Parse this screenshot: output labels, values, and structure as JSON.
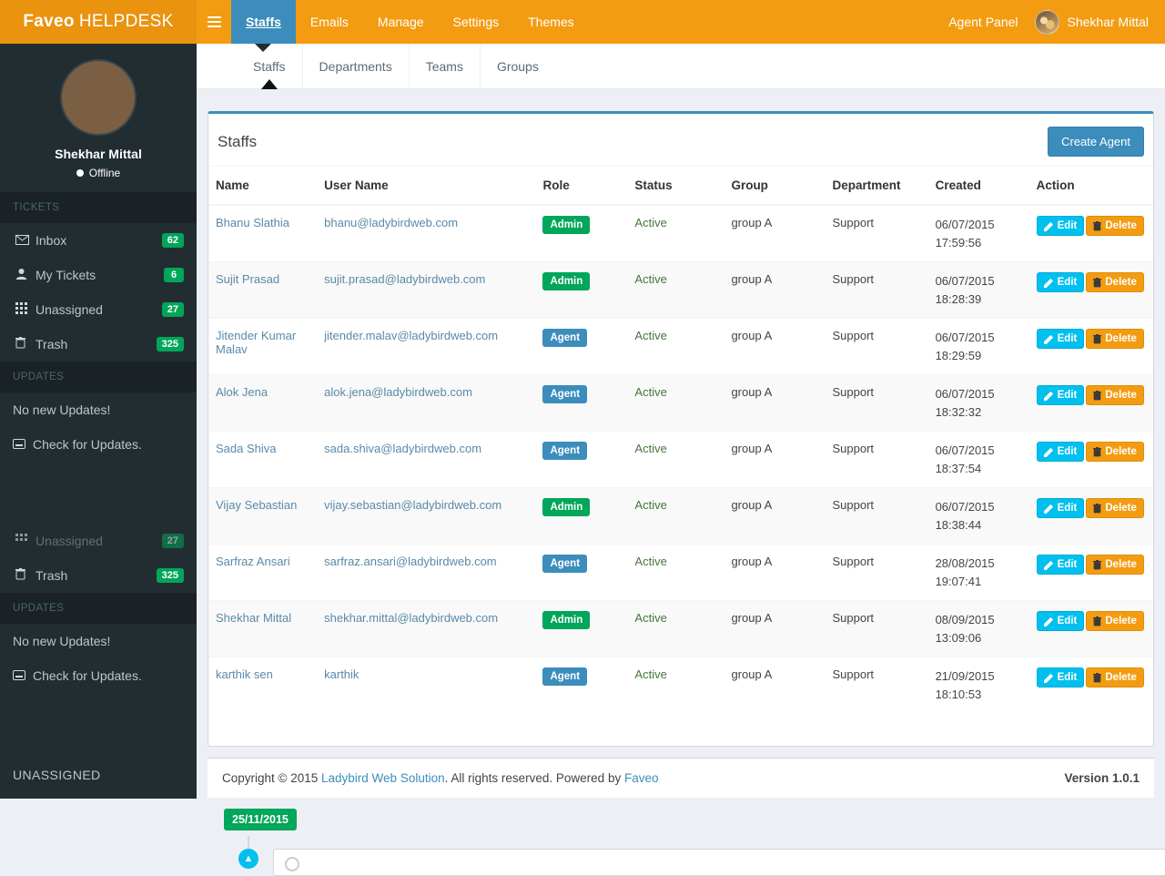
{
  "navbar": {
    "brand_bold": "Faveo",
    "brand_light": "HELPDESK",
    "menu_icon": "hamburger-icon",
    "items": [
      {
        "label": "Staffs",
        "active": true
      },
      {
        "label": "Emails",
        "active": false
      },
      {
        "label": "Manage",
        "active": false
      },
      {
        "label": "Settings",
        "active": false
      },
      {
        "label": "Themes",
        "active": false
      }
    ],
    "agent_panel_label": "Agent Panel",
    "user_name": "Shekhar Mittal"
  },
  "sidebar": {
    "user_name": "Shekhar Mittal",
    "user_status": "Offline",
    "tickets_header": "TICKETS",
    "tickets": [
      {
        "label": "Inbox",
        "badge": "62",
        "icon": "envelope-icon"
      },
      {
        "label": "My Tickets",
        "badge": "6",
        "icon": "user-icon"
      },
      {
        "label": "Unassigned",
        "badge": "27",
        "icon": "grid-icon"
      },
      {
        "label": "Trash",
        "badge": "325",
        "icon": "trash-icon"
      }
    ],
    "updates_header": "UPDATES",
    "no_updates": "No new Updates!",
    "check_updates": "Check for Updates.",
    "bottom_label": "UNASSIGNED",
    "dup": {
      "unassigned_label": "Unassigned",
      "unassigned_badge": "27",
      "trash_label": "Trash",
      "trash_badge": "325",
      "updates_header": "UPDATES",
      "no_updates": "No new Updates!",
      "check_updates": "Check for Updates."
    }
  },
  "subtabs": [
    {
      "label": "Staffs",
      "active": true
    },
    {
      "label": "Departments",
      "active": false
    },
    {
      "label": "Teams",
      "active": false
    },
    {
      "label": "Groups",
      "active": false
    }
  ],
  "panel": {
    "title": "Staffs",
    "create_button": "Create Agent",
    "columns": [
      "Name",
      "User Name",
      "Role",
      "Status",
      "Group",
      "Department",
      "Created",
      "Action"
    ],
    "edit_label": "Edit",
    "delete_label": "Delete",
    "rows": [
      {
        "name": "Bhanu Slathia",
        "username": "bhanu@ladybirdweb.com",
        "role": "Admin",
        "role_type": "admin",
        "status": "Active",
        "group": "group A",
        "department": "Support",
        "created_date": "06/07/2015",
        "created_time": "17:59:56"
      },
      {
        "name": "Sujit Prasad",
        "username": "sujit.prasad@ladybirdweb.com",
        "role": "Admin",
        "role_type": "admin",
        "status": "Active",
        "group": "group A",
        "department": "Support",
        "created_date": "06/07/2015",
        "created_time": "18:28:39"
      },
      {
        "name": "Jitender Kumar Malav",
        "username": "jitender.malav@ladybirdweb.com",
        "role": "Agent",
        "role_type": "agent",
        "status": "Active",
        "group": "group A",
        "department": "Support",
        "created_date": "06/07/2015",
        "created_time": "18:29:59"
      },
      {
        "name": "Alok Jena",
        "username": "alok.jena@ladybirdweb.com",
        "role": "Agent",
        "role_type": "agent",
        "status": "Active",
        "group": "group A",
        "department": "Support",
        "created_date": "06/07/2015",
        "created_time": "18:32:32"
      },
      {
        "name": "Sada Shiva",
        "username": "sada.shiva@ladybirdweb.com",
        "role": "Agent",
        "role_type": "agent",
        "status": "Active",
        "group": "group A",
        "department": "Support",
        "created_date": "06/07/2015",
        "created_time": "18:37:54"
      },
      {
        "name": "Vijay Sebastian",
        "username": "vijay.sebastian@ladybirdweb.com",
        "role": "Admin",
        "role_type": "admin",
        "status": "Active",
        "group": "group A",
        "department": "Support",
        "created_date": "06/07/2015",
        "created_time": "18:38:44"
      },
      {
        "name": "Sarfraz Ansari",
        "username": "sarfraz.ansari@ladybirdweb.com",
        "role": "Agent",
        "role_type": "agent",
        "status": "Active",
        "group": "group A",
        "department": "Support",
        "created_date": "28/08/2015",
        "created_time": "19:07:41"
      },
      {
        "name": "Shekhar Mittal",
        "username": "shekhar.mittal@ladybirdweb.com",
        "role": "Admin",
        "role_type": "admin",
        "status": "Active",
        "group": "group A",
        "department": "Support",
        "created_date": "08/09/2015",
        "created_time": "13:09:06"
      },
      {
        "name": "karthik sen",
        "username": "karthik",
        "role": "Agent",
        "role_type": "agent",
        "status": "Active",
        "group": "group A",
        "department": "Support",
        "created_date": "21/09/2015",
        "created_time": "18:10:53"
      }
    ]
  },
  "footer": {
    "copyright_prefix": "Copyright © 2015 ",
    "company": "Ladybird Web Solution",
    "copyright_middle": ". All rights reserved. Powered by ",
    "powered_by": "Faveo",
    "version": "Version 1.0.1"
  },
  "timeline": {
    "date_label": "25/11/2015"
  },
  "colors": {
    "brand_orange": "#f39c12",
    "accent_blue": "#3c8dbc",
    "success_green": "#00a65a",
    "edit_blue": "#00c0ef",
    "delete_orange": "#f39c12",
    "sidebar_dark": "#222d32"
  }
}
